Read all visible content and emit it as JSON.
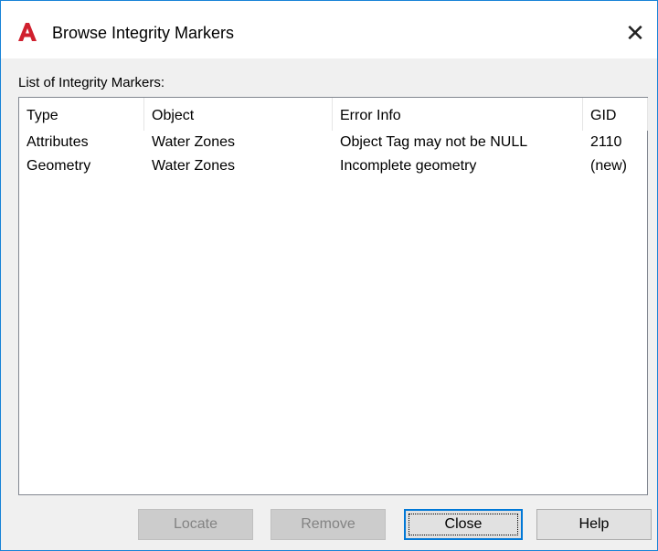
{
  "window": {
    "title": "Browse Integrity Markers",
    "app_icon": "autocad-a-icon",
    "close_glyph": "✕"
  },
  "list": {
    "label": "List of Integrity Markers:",
    "columns": [
      "Type",
      "Object",
      "Error Info",
      "GID"
    ],
    "rows": [
      [
        "Attributes",
        "Water Zones",
        "Object Tag may not be NULL",
        "2110"
      ],
      [
        "Geometry",
        "Water Zones",
        "Incomplete geometry",
        "(new)"
      ]
    ]
  },
  "buttons": {
    "locate": "Locate",
    "remove": "Remove",
    "close": "Close",
    "help": "Help"
  },
  "colors": {
    "accent": "#0078d7",
    "window_border": "#1883d7",
    "app_icon_red": "#d0202e"
  }
}
